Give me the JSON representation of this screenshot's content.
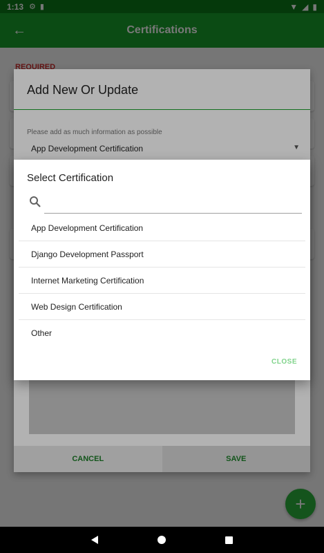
{
  "status_bar": {
    "time": "1:13",
    "icons": [
      "gear-icon",
      "sim-icon",
      "wifi-icon",
      "cell-icon",
      "battery-icon"
    ]
  },
  "app_bar": {
    "title": "Certifications",
    "back_icon": "arrow-back-icon"
  },
  "page": {
    "required_label": "REQUIRED"
  },
  "outer_dialog": {
    "title": "Add New Or Update",
    "hint": "Please add as much information as possible",
    "selected_certification": "App Development Certification",
    "cancel_label": "CANCEL",
    "save_label": "SAVE"
  },
  "select_dialog": {
    "title": "Select Certification",
    "search": {
      "value": "",
      "placeholder": ""
    },
    "options": [
      "App Development Certification",
      "Django Development Passport",
      "Internet Marketing Certification",
      "Web Design Certification",
      "Other"
    ],
    "close_label": "CLOSE"
  },
  "fab": {
    "icon": "plus-icon",
    "label": "+"
  },
  "colors": {
    "primary": "#1a9f2b",
    "primary_dark": "#0d7a1a",
    "accent_text": "#1a7a26",
    "close_text": "#7fd38a",
    "required": "#d32f2f"
  }
}
